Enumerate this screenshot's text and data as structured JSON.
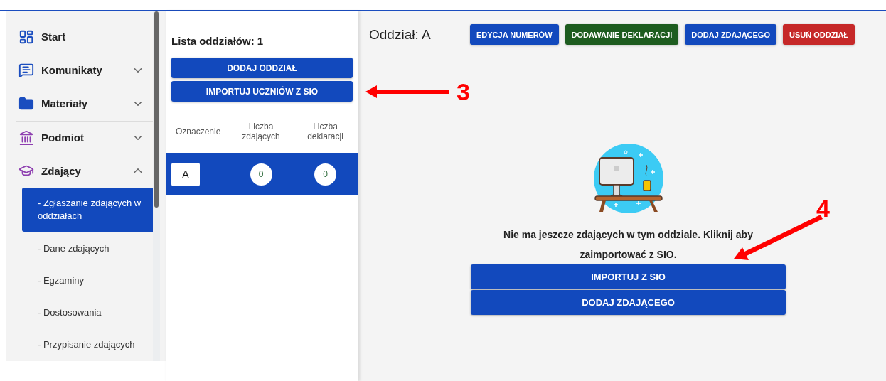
{
  "sidebar": {
    "items": [
      {
        "kind": "link",
        "label": "Start",
        "color": "#1a4dbf",
        "divider": false
      },
      {
        "kind": "group",
        "label": "Komunikaty",
        "color": "#1a4dbf",
        "expanded": false,
        "divider": false
      },
      {
        "kind": "group",
        "label": "Materiały",
        "color": "#1a4dbf",
        "expanded": false,
        "divider": false
      },
      {
        "kind": "group",
        "label": "Podmiot",
        "color": "#8e3fb0",
        "expanded": false,
        "divider": true
      },
      {
        "kind": "group",
        "label": "Zdający",
        "color": "#8e3fb0",
        "expanded": true,
        "divider": false,
        "children": [
          {
            "label": "- Zgłaszanie zdających w oddziałach",
            "selected": true
          },
          {
            "label": "- Dane zdających",
            "selected": false
          },
          {
            "label": "- Egzaminy",
            "selected": false
          },
          {
            "label": "- Dostosowania",
            "selected": false
          },
          {
            "label": "- Przypisanie zdających",
            "selected": false
          }
        ]
      }
    ]
  },
  "branch_list": {
    "title": "Lista oddziałów: 1",
    "buttons": [
      "DODAJ ODDZIAŁ",
      "IMPORTUJ UCZNIÓW Z SIO"
    ],
    "columns": [
      "Oznaczenie",
      "Liczba zdających",
      "Liczba deklaracji"
    ],
    "rows": [
      {
        "label": "A",
        "students": "0",
        "declarations": "0",
        "selected": true
      }
    ]
  },
  "branch": {
    "title": "Oddział: A",
    "actions": [
      {
        "label": "EDYCJA NUMERÓW",
        "color": "#1249bd"
      },
      {
        "label": "DODAWANIE DEKLARACJI",
        "color": "#1d5c1f"
      },
      {
        "label": "DODAJ ZDAJĄCEGO",
        "color": "#1249bd"
      },
      {
        "label": "USUŃ ODDZIAŁ",
        "color": "#c62828"
      }
    ],
    "empty_message": "Nie ma jeszcze zdających w tym oddziale. Kliknij aby zaimportować z SIO.",
    "empty_buttons": [
      "IMPORTUJ Z SIO",
      "DODAJ ZDAJĄCEGO"
    ]
  },
  "annotations": [
    {
      "label": "3"
    },
    {
      "label": "4"
    }
  ]
}
